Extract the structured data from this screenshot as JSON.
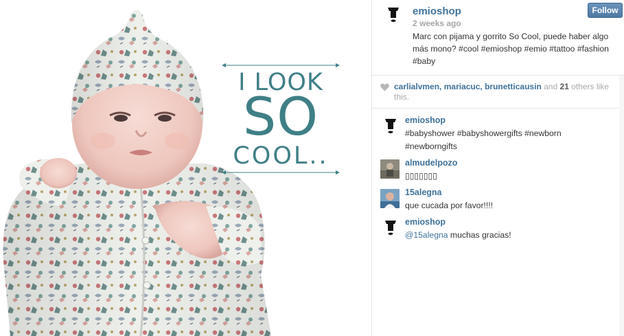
{
  "post": {
    "slogan": {
      "line1": "I LOOK",
      "line2": "SO",
      "line3": "COOL.."
    },
    "author": "emioshop",
    "time_ago": "2 weeks ago",
    "follow_label": "Follow",
    "caption": "Marc con pijama y gorrito So Cool, puede haber algo más mono? #cool #emioshop #emio #tattoo #fashion #baby"
  },
  "likes": {
    "users": [
      "carlialvmen",
      "mariacuc",
      "brunetticausin"
    ],
    "sep1": ", ",
    "sep2": ", ",
    "and_text": " and ",
    "others_count": "21",
    "others_text": " others like this."
  },
  "comments": [
    {
      "user": "emioshop",
      "text": "#babyshower #babyshowergifts #newborn #newborngifts",
      "avatar": "emio-logo-icon"
    },
    {
      "user": "almudelpozo",
      "text": "▯▯▯▯▯▯▯",
      "avatar": "user-photo"
    },
    {
      "user": "15alegna",
      "text": "que cucada por favor!!!!",
      "avatar": "user-photo"
    },
    {
      "user": "emioshop",
      "mention": "@15alegna",
      "text": " muchas gracias!",
      "avatar": "emio-logo-icon"
    }
  ],
  "colors": {
    "link": "#3f729b",
    "slogan": "#3f7f86",
    "follow": "#517fa4"
  }
}
